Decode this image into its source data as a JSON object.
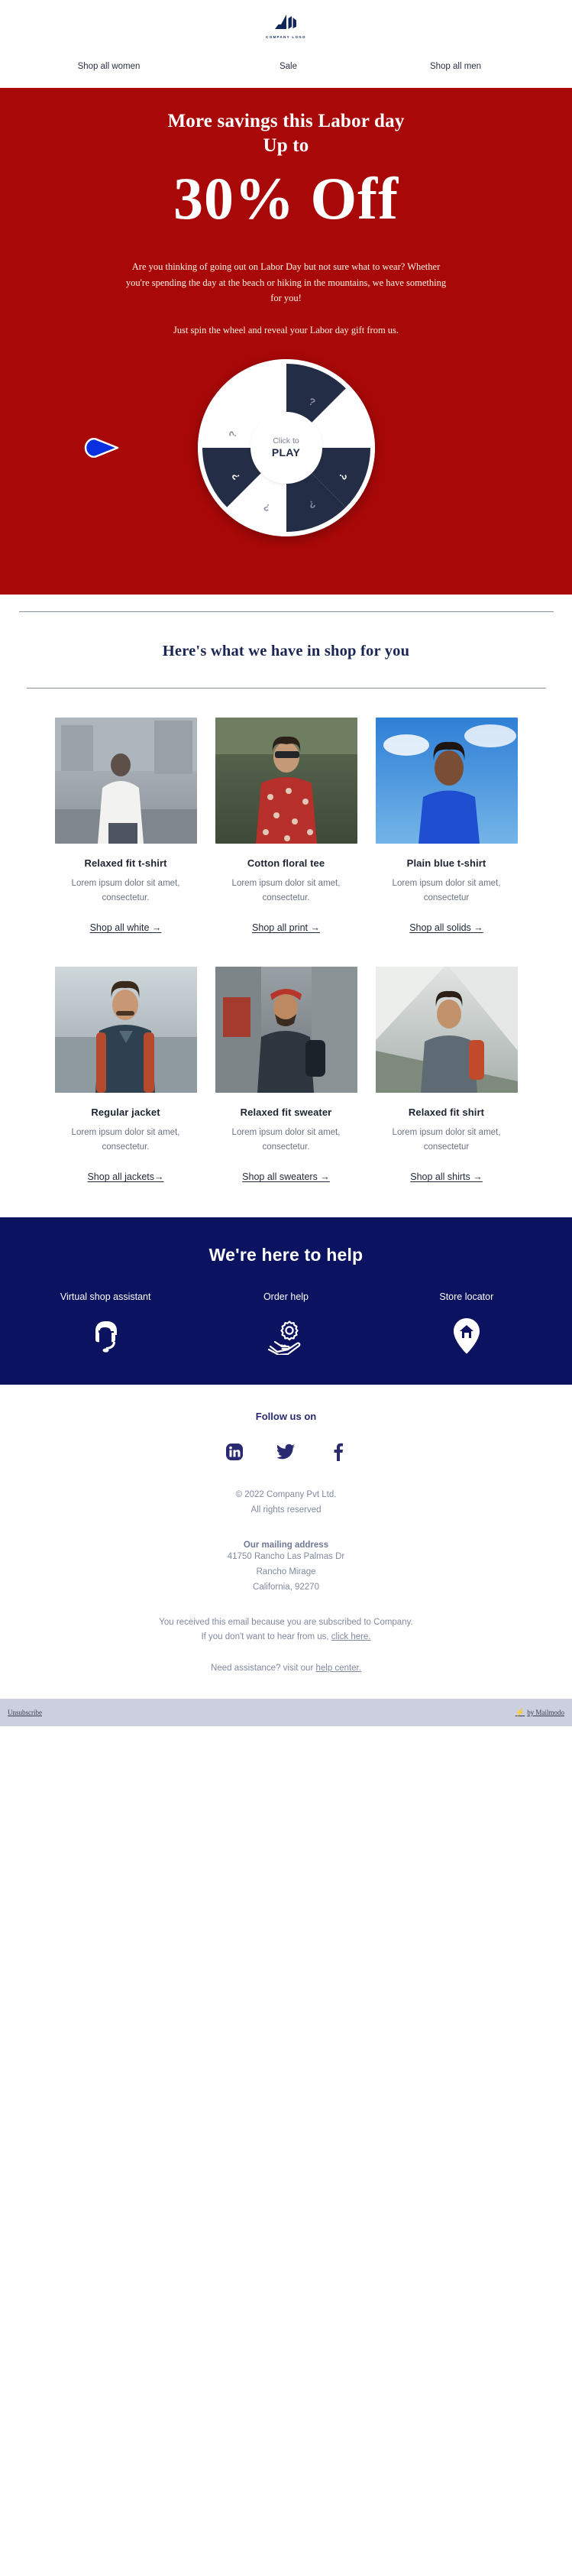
{
  "brand": {
    "logo_text": "COMPANY LOGO",
    "logo_icon": "leaf-logo-icon",
    "colors": {
      "red": "#a80808",
      "navy": "#0b1260",
      "dark": "#222b45",
      "blue_pointer": "#0a2fe0"
    }
  },
  "nav": {
    "items": [
      {
        "label": "Shop all women"
      },
      {
        "label": "Sale"
      },
      {
        "label": "Shop all men"
      }
    ]
  },
  "hero": {
    "headline_line1": "More savings this Labor day",
    "headline_line2": "Up to",
    "discount": "30% Off",
    "paragraph_1": "Are you thinking of going out on Labor Day but not sure what to wear? Whether you're spending the day at the beach or hiking in the mountains, we have something for you!",
    "paragraph_2": "Just spin the wheel and reveal your Labor day gift from us.",
    "wheel": {
      "segment_label": "?",
      "segment_count": 8,
      "hub_line1": "Click to",
      "hub_line2": "PLAY",
      "pointer_icon": "wheel-pointer-icon"
    }
  },
  "shop": {
    "heading": "Here's what we have in shop for you",
    "products": [
      {
        "title": "Relaxed fit t-shirt",
        "description": "Lorem ipsum dolor sit amet, consectetur.",
        "link": "Shop all white →",
        "image_name": "man-in-white-tshirt-street-photo"
      },
      {
        "title": "Cotton floral tee",
        "description": "Lorem ipsum dolor sit amet, consectetur.",
        "link": "Shop all print →",
        "image_name": "man-in-floral-shirt-sunglasses-photo"
      },
      {
        "title": "Plain blue t-shirt",
        "description": "Lorem ipsum dolor sit amet, consectetur",
        "link": "Shop all solids →",
        "image_name": "man-in-blue-tshirt-sky-photo"
      },
      {
        "title": "Regular jacket",
        "description": "Lorem ipsum dolor sit amet, consectetur.",
        "link": "Shop all jackets→",
        "image_name": "man-in-jacket-outdoor-photo"
      },
      {
        "title": "Relaxed fit sweater",
        "description": "Lorem ipsum dolor sit amet, consectetur.",
        "link": "Shop all sweaters →",
        "image_name": "man-with-backpack-red-cap-photo"
      },
      {
        "title": "Relaxed fit shirt",
        "description": "Lorem ipsum dolor sit amet, consectetur",
        "link": "Shop all shirts →",
        "image_name": "man-camping-tent-photo"
      }
    ]
  },
  "help": {
    "heading": "We're here to help",
    "items": [
      {
        "label": "Virtual shop assistant",
        "icon": "headset-agent-icon"
      },
      {
        "label": "Order help",
        "icon": "hand-holding-gear-icon"
      },
      {
        "label": "Store locator",
        "icon": "map-pin-home-icon"
      }
    ]
  },
  "footer": {
    "follow_label": "Follow us on",
    "socials": [
      {
        "name": "linkedin-icon",
        "label": "LinkedIn"
      },
      {
        "name": "twitter-icon",
        "label": "Twitter"
      },
      {
        "name": "facebook-icon",
        "label": "Facebook"
      }
    ],
    "copyright_line1": "© 2022 Company Pvt Ltd.",
    "copyright_line2": "All rights reserved",
    "address_heading": "Our mailing address",
    "address_line1": "41750 Rancho Las Palmas Dr",
    "address_line2": "Rancho Mirage",
    "address_line3": "California, 92270",
    "legal_line1": "You received this email because you are subscribed to Company.",
    "legal_line2_prefix": "If you don't want to hear from us, ",
    "legal_line2_link": "click here.",
    "assistance_prefix": "Need assistance? visit our ",
    "assistance_link": "help center.",
    "unsubscribe": "Unsubscribe",
    "provider": "by Mailmodo"
  }
}
